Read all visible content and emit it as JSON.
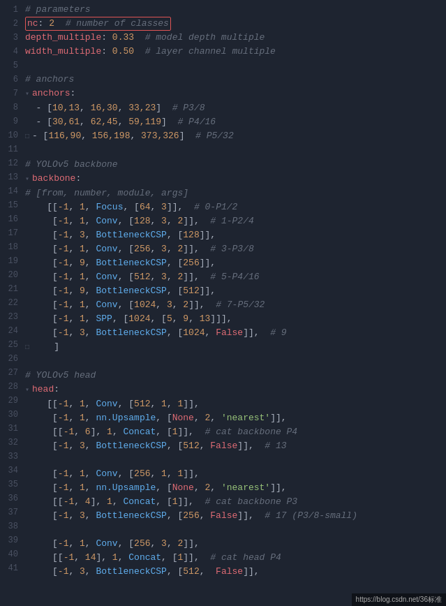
{
  "editor": {
    "background": "#1e2430",
    "lines": [
      {
        "num": 1,
        "indent": 2,
        "content": "# parameters",
        "type": "comment"
      },
      {
        "num": 2,
        "indent": 2,
        "content": "nc: 2  # number of classes",
        "type": "highlight",
        "highlight_text": "nc: 2  # number of classes"
      },
      {
        "num": 3,
        "indent": 2,
        "content": "depth_multiple: 0.33  # model depth multiple",
        "type": "mixed"
      },
      {
        "num": 4,
        "indent": 2,
        "content": "width_multiple: 0.50  # layer channel multiple",
        "type": "mixed"
      },
      {
        "num": 5,
        "indent": 0,
        "content": "",
        "type": "empty"
      },
      {
        "num": 6,
        "indent": 2,
        "content": "# anchors",
        "type": "comment"
      },
      {
        "num": 7,
        "indent": 0,
        "content": "anchors:",
        "type": "key",
        "fold": true
      },
      {
        "num": 8,
        "indent": 4,
        "content": "- [10,13, 16,30, 33,23]  # P3/8",
        "type": "list"
      },
      {
        "num": 9,
        "indent": 4,
        "content": "- [30,61, 62,45, 59,119]  # P4/16",
        "type": "list"
      },
      {
        "num": 10,
        "indent": 2,
        "content": "- [116,90, 156,198, 373,326]  # P5/32",
        "type": "list",
        "fold": true
      },
      {
        "num": 11,
        "indent": 0,
        "content": "",
        "type": "empty"
      },
      {
        "num": 12,
        "indent": 2,
        "content": "# YOLOv5 backbone",
        "type": "comment"
      },
      {
        "num": 13,
        "indent": 0,
        "content": "backbone:",
        "type": "key",
        "fold": true
      },
      {
        "num": 14,
        "indent": 4,
        "content": "# [from, number, module, args]",
        "type": "comment"
      },
      {
        "num": 15,
        "indent": 4,
        "content": "[[-1, 1, Focus, [64, 3]],  # 0-P1/2",
        "type": "list"
      },
      {
        "num": 16,
        "indent": 5,
        "content": "[-1, 1, Conv, [128, 3, 2]],  # 1-P2/4",
        "type": "list"
      },
      {
        "num": 17,
        "indent": 5,
        "content": "[-1, 3, BottleneckCSP, [128]],",
        "type": "list"
      },
      {
        "num": 18,
        "indent": 5,
        "content": "[-1, 1, Conv, [256, 3, 2]],  # 3-P3/8",
        "type": "list"
      },
      {
        "num": 19,
        "indent": 5,
        "content": "[-1, 9, BottleneckCSP, [256]],",
        "type": "list"
      },
      {
        "num": 20,
        "indent": 5,
        "content": "[-1, 1, Conv, [512, 3, 2]],  # 5-P4/16",
        "type": "list"
      },
      {
        "num": 21,
        "indent": 5,
        "content": "[-1, 9, BottleneckCSP, [512]],",
        "type": "list"
      },
      {
        "num": 22,
        "indent": 5,
        "content": "[-1, 1, Conv, [1024, 3, 2]],  # 7-P5/32",
        "type": "list"
      },
      {
        "num": 23,
        "indent": 5,
        "content": "[-1, 1, SPP, [1024, [5, 9, 13]]],",
        "type": "list"
      },
      {
        "num": 24,
        "indent": 5,
        "content": "[-1, 3, BottleneckCSP, [1024, False]],  # 9",
        "type": "list"
      },
      {
        "num": 25,
        "indent": 4,
        "content": "]",
        "type": "bracket",
        "fold": true
      },
      {
        "num": 26,
        "indent": 0,
        "content": "",
        "type": "empty"
      },
      {
        "num": 27,
        "indent": 2,
        "content": "# YOLOv5 head",
        "type": "comment"
      },
      {
        "num": 28,
        "indent": 0,
        "content": "head:",
        "type": "key",
        "fold": true
      },
      {
        "num": 29,
        "indent": 4,
        "content": "[[-1, 1, Conv, [512, 1, 1]],",
        "type": "list"
      },
      {
        "num": 30,
        "indent": 5,
        "content": "[-1, 1, nn.Upsample, [None, 2, 'nearest']],",
        "type": "list"
      },
      {
        "num": 31,
        "indent": 5,
        "content": "[[-1, 6], 1, Concat, [1]],  # cat backbone P4",
        "type": "list"
      },
      {
        "num": 32,
        "indent": 5,
        "content": "[-1, 3, BottleneckCSP, [512, False]],  # 13",
        "type": "list"
      },
      {
        "num": 33,
        "indent": 0,
        "content": "",
        "type": "empty"
      },
      {
        "num": 34,
        "indent": 5,
        "content": "[-1, 1, Conv, [256, 1, 1]],",
        "type": "list"
      },
      {
        "num": 35,
        "indent": 5,
        "content": "[-1, 1, nn.Upsample, [None, 2, 'nearest']],",
        "type": "list"
      },
      {
        "num": 36,
        "indent": 5,
        "content": "[[-1, 4], 1, Concat, [1]],  # cat backbone P3",
        "type": "list"
      },
      {
        "num": 37,
        "indent": 5,
        "content": "[-1, 3, BottleneckCSP, [256, False]],  # 17 (P3/8-small)",
        "type": "list"
      },
      {
        "num": 38,
        "indent": 0,
        "content": "",
        "type": "empty"
      },
      {
        "num": 39,
        "indent": 5,
        "content": "[-1, 1, Conv, [256, 3, 2]],",
        "type": "list"
      },
      {
        "num": 40,
        "indent": 5,
        "content": "[[-1, 14], 1, Concat, [1]],  # cat head P4",
        "type": "list"
      },
      {
        "num": 41,
        "indent": 5,
        "content": "[-1, 3, BottleneckCSP, [512,  False]],",
        "type": "list"
      }
    ]
  },
  "watermark": "https://blog.csdn.net/36标准"
}
